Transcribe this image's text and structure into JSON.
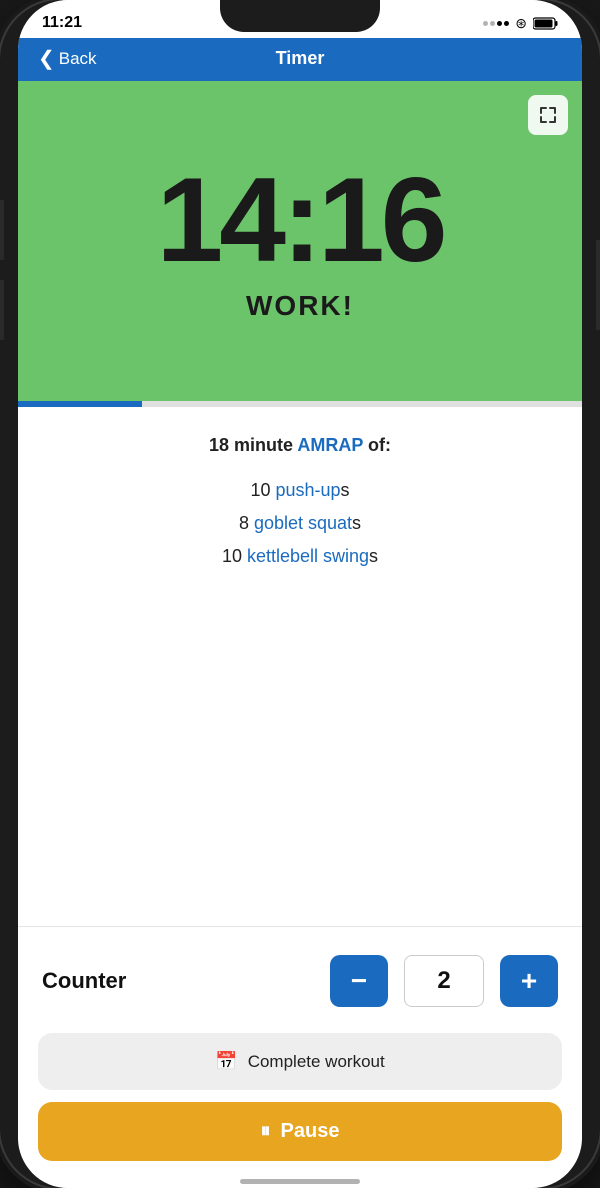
{
  "status_bar": {
    "time": "11:21"
  },
  "nav": {
    "back_label": "Back",
    "title": "Timer"
  },
  "timer": {
    "display": "14:16",
    "phase_label": "WORK!",
    "progress_percent": 22,
    "bg_color": "#6cc46a"
  },
  "workout": {
    "description_prefix": "18 minute ",
    "amrap_label": "AMRAP",
    "description_suffix": " of:",
    "exercises": [
      {
        "count": "10",
        "link_text": "push-up",
        "suffix": "s"
      },
      {
        "count": "8",
        "link_text": "goblet squat",
        "suffix": "s"
      },
      {
        "count": "10",
        "link_text": "kettlebell swing",
        "suffix": "s"
      }
    ]
  },
  "counter": {
    "label": "Counter",
    "value": "2",
    "decrement_label": "−",
    "increment_label": "+"
  },
  "actions": {
    "complete_label": "Complete workout",
    "pause_label": "Pause"
  },
  "icons": {
    "back_chevron": "‹",
    "fullscreen": "⛶",
    "calendar": "📅",
    "pause_bars": "⏸"
  }
}
